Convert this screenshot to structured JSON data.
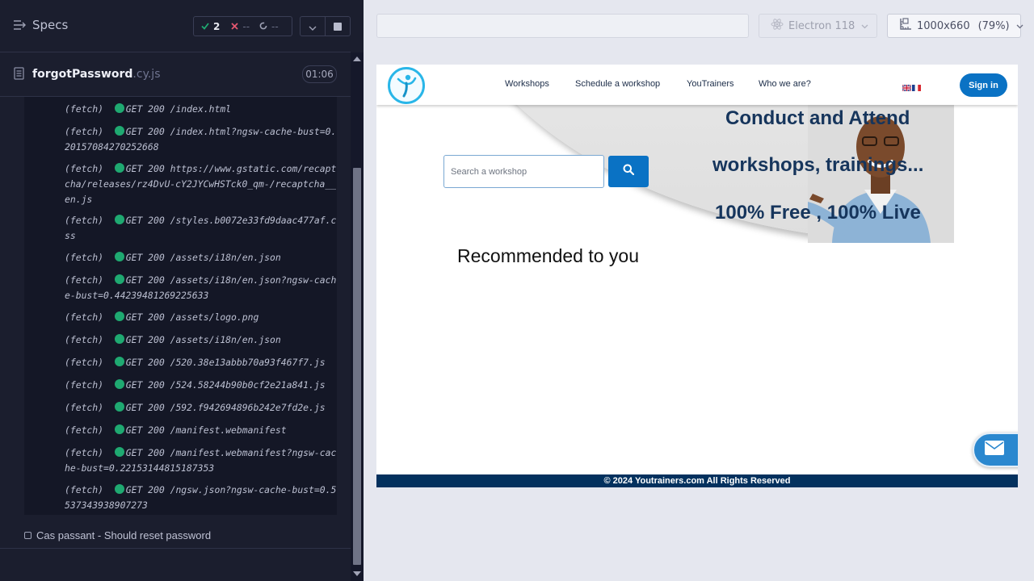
{
  "runner": {
    "specs_label": "Specs",
    "stats": {
      "passed": "2",
      "failed": "--",
      "pending": "--"
    },
    "file": {
      "name": "forgotPassword",
      "ext": ".cy.js",
      "duration": "01:06"
    },
    "log_prefix": "(fetch)",
    "log_entries": [
      "GET 200 /index.html",
      "GET 200 /index.html?ngsw-cache-bust=0.20157084270252668",
      "GET 200 https://www.gstatic.com/recaptcha/releases/rz4DvU-cY2JYCwHSTck0_qm-/recaptcha__en.js",
      "GET 200 /styles.b0072e33fd9daac477af.css",
      "GET 200 /assets/i18n/en.json",
      "GET 200 /assets/i18n/en.json?ngsw-cache-bust=0.44239481269225633",
      "GET 200 /assets/logo.png",
      "GET 200 /assets/i18n/en.json",
      "GET 200 /520.38e13abbb70a93f467f7.js",
      "GET 200 /524.58244b90b0cf2e21a841.js",
      "GET 200 /592.f942694896b242e7fd2e.js",
      "GET 200 /manifest.webmanifest",
      "GET 200 /manifest.webmanifest?ngsw-cache-bust=0.22153144815187353",
      "GET 200 /ngsw.json?ngsw-cache-bust=0.5537343938907273"
    ],
    "test_title": "Cas passant - Should reset password",
    "status_color": "#1fa971"
  },
  "browser": {
    "url": "",
    "browser_name": "Electron 118",
    "viewport": "1000x660",
    "zoom": "(79%)"
  },
  "app": {
    "nav": [
      "Workshops",
      "Schedule a workshop",
      "YouTrainers",
      "Who we are?"
    ],
    "signin": "Sign in",
    "search_placeholder": "Search a workshop",
    "hero": {
      "line1": "Conduct and Attend",
      "line2": "workshops, trainings...",
      "line3": "100% Free , 100% Live"
    },
    "recommended": "Recommended to you",
    "footer": "© 2024 Youtrainers.com All Rights Reserved",
    "brand_color": "#0a72c4",
    "footer_color": "#03315e"
  }
}
